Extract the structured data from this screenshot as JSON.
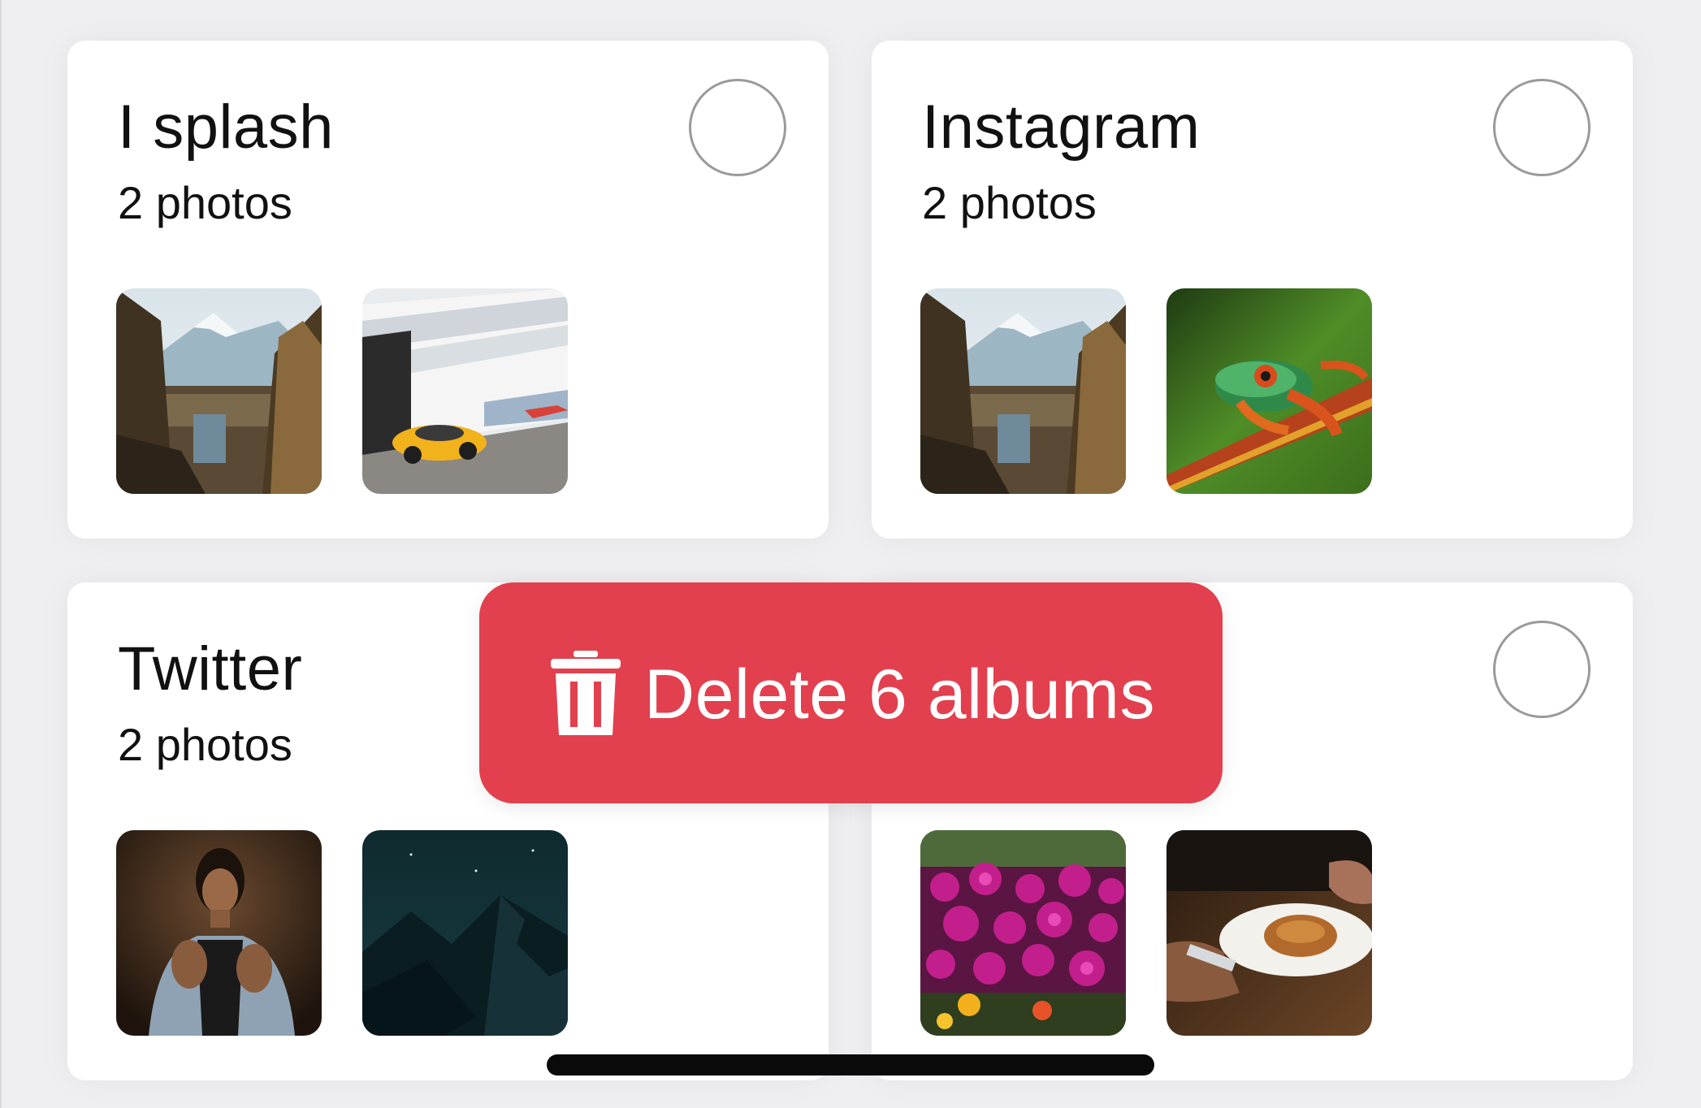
{
  "albums": [
    {
      "title": "I splash",
      "count": "2 photos",
      "photos": [
        "mountain-landscape",
        "yellow-sports-car"
      ]
    },
    {
      "title": "Instagram",
      "count": "2 photos",
      "photos": [
        "mountain-landscape",
        "tree-frog"
      ]
    },
    {
      "title": "Twitter",
      "count": "2 photos",
      "photos": [
        "woman-portrait",
        "night-mountains"
      ]
    },
    {
      "title": "",
      "count": "",
      "photos": [
        "pink-flowers",
        "croissant-plate"
      ]
    }
  ],
  "action": {
    "label": "Delete 6 albums",
    "icon": "trash-icon",
    "color": "#e2404e"
  },
  "colors": {
    "background": "#efeff1",
    "card": "#ffffff",
    "circle_border": "#9a9a9a"
  }
}
